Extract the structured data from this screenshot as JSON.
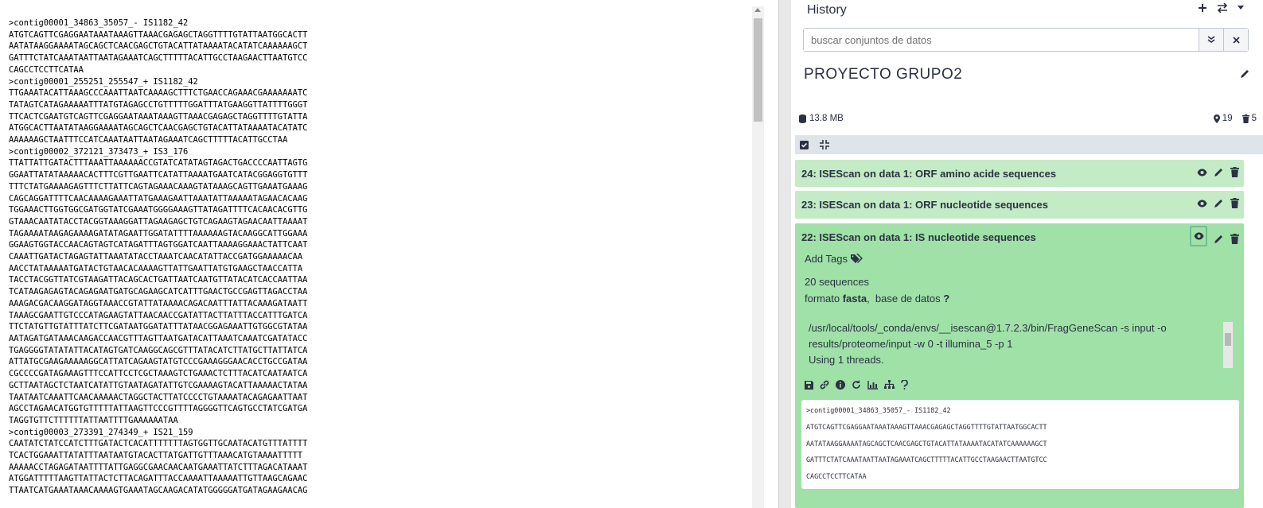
{
  "fasta_text": ">contig00001_34863_35057_- IS1182_42\nATGTCAGTTCGAGGAATAAATAAAGTTAAACGAGAGCTAGGTTTTGTATTAATGGCACTT\nAATATAAGGAAAATAGCAGCTCAACGAGCTGTACATTATAAAATACATATCAAAAAAGCT\nGATTTCTATCAAATAATTAATAGAAATCAGCTTTTTACATTGCCTAAGAACTTAATGTCC\nCAGCCTCCTTCATAA\n>contig00001_255251_255547_+ IS1182_42\nTTGAAATACATTAAAGCCCAAATTAATCAAAAGCTTTCTGAACCAGAAACGAAAAAAATC\nTATAGTCATAGAAAAATTTATGTAGAGCCTGTTTTTGGATTTATGAAGGTTATTTTGGGT\nTTCACTCGAATGTCAGTTCGAGGAATAAATAAAGTTAAACGAGAGCTAGGTTTTGTATTA\nATGGCACTTAATATAAGGAAAATAGCAGCTCAACGAGCTGTACATTATAAAATACATATC\nAAAAAAGCTAATTTCCATCAAATAATTAATAGAAATCAGCTTTTTACATTGCCTAA\n>contig00002_372121_373473_+ IS3_176\nTTATTATTGATACTTTAAATTAAAAAACCGTATCATATAGTAGACTGACCCCAATTAGTG\nGGAATTATATAAAAACACTTTCGTTGAATTCATATTAAAATGAATCATACGGAGGTGTTT\nTTTCTATGAAAAGAGTTTCTTATTCAGTAGAAACAAAGTATAAAGCAGTTGAAATGAAAG\nCAGCAGGATTTTCAACAAAAGAAATTATGAAAGAATTAAATATTAAAAATAGAACACAAG\nTGGAAACTTGGTGGCGATGGTATCGAAATGGGGAAAGTTATAGATTTTCACAACACGTTG\nGTAAACAATATACCTACGGTAAAGGATTAGAAGAGCTGTCAGAAGTAGAACAATTAAAAT\nTAGAAAATAAGAGAAAAGATATAGAATTGGATATTTTAAAAAAGTACAAGGCATTGGAAA\nGGAAGTGGTACCAACAGTAGTCATAGATTTAGTGGATCAATTAAAAGGAAACTATTCAAT\nCAAATTGATACTAGAGTATTAAATATACCTAAATCAACATATTACCGATGGAAAAACAA\nAACCTATAAAAATGATACTGTAACACAAAAGTTATTGAATTATGTGAAGCTAACCATTA\nTACCTACGGTTATCGTAAGATTACAGCACTGATTAATCAATGTTATACATCACCAATTAA\nTCATAAGAGAGTACAGAGAATGATGCAGAAGCATCATTTGAACTGCCGAGTTAGACCTAA\nAAAGACGACAAGGATAGGTAAACCGTATTATAAAACAGACAATTTATTACAAAGATAATT\nTAAAGCGAATTGTCCCATAGAAGTATTAACAACCGATATTACTTATTTACCATTTGATCA\nTTCTATGTTGTATTTATCTTCGATAATGGATATTTATAACGGAGAAATTGTGGCGTATAA\nAATAGATGATAAACAAGACCAACGTTTAGTTAATGATACATTAAATCAAATCGATATACC\nTGAGGGGTATATATTACATAGTGATCAAGGCAGCGTTTATACATCTTATGCTTATTATCA\nATTATGCGAAGAAAAAGGCATTATCAGAAGTATGTCCCGAAAGGGAACACCTGCCGATAA\nCGCCCCGATAGAAAGTTTCCATTCCTCGCTAAAGTCTGAAACTCTTTACATCAATAATCA\nGCTTAATAGCTCTAATCATATTGTAATAGATATTGTCGAAAAGTACATTAAAAACTATAA\nTAATAATCAAATTCAACAAAAACTAGGCTACTTATCCCCTGTAAAATACAGAGAATTAAT\nAGCCTAGAACATGGTGTTTTTATTAAGTTCCCGTTTTAGGGGTTCAGTGCCTATCGATGA\nTAGGTGTTCTTTTTTATTAATTTTGAAAAAATAA\n>contig00003_273391_274349_+ IS21_159\nCAATATCTATCCATCTTTGATACTCACATTTTTTTAGTGGTTGCAATACATGTTTATTTT\nTCACTGGAAATTATATTTAATAATGTACACTTATGATTGTTTAAACATGTAAAATTTTT\nAAAAACCTAGAGATAATTTTATTGAGGCGAACAACAATGAAATTATCTTTAGACATAAAT\nATGGATTTTTAAGTTATTACTCTTACAGATTTACCAAAATTAAAAATTGTTAAGCAGAAC\nTTAATCATGAAATAAACAAAAGTGAAATAGCAAGACATATGGGGGATGATAGAAGAACAG",
  "history": {
    "title": "History",
    "search_placeholder": "buscar conjuntos de datos",
    "name": "PROYECTO GRUPO2",
    "size": "13.8 MB",
    "shown_count": "19",
    "deleted_count": "5",
    "datasets": [
      {
        "title": "24: ISEScan on data 1: ORF amino acide sequences"
      },
      {
        "title": "23: ISEScan on data 1: ORF nucleotide sequences"
      },
      {
        "title": "22: ISEScan on data 1: IS nucleotide sequences"
      }
    ],
    "expanded": {
      "add_tags": "Add Tags",
      "sequences": "20 sequences",
      "format_label": "formato",
      "format_value": "fasta",
      "db_label": ",  base de datos",
      "db_value": "?",
      "info_lines": [
        "/usr/local/tools/_conda/envs/__isescan@1.7.2.3/bin/FragGeneScan -s input -o",
        "results/proteome/input -w 0 -t illumina_5 -p 1",
        "Using 1 threads."
      ],
      "peek_lines": [
        ">contig00001_34863_35057_- IS1182_42",
        "ATGTCAGTTCGAGGAATAAATAAAGTTAAACGAGAGCTAGGTTTTGTATTAATGGCACTT",
        "AATATAAGGAAAATAGCAGCTCAACGAGCTGTACATTATAAAATACATATCAAAAAAGCT",
        "GATTTCTATCAAATAATTAATAGAAATCAGCTTTTTACATTGCCTAAGAACTTAATGTCC",
        "CAGCCTCCTTCATAA"
      ]
    }
  },
  "colors": {
    "dataset_ok": "#c3ebc6",
    "dataset_ok_open": "#9fe1a7",
    "text": "#2c3143"
  }
}
